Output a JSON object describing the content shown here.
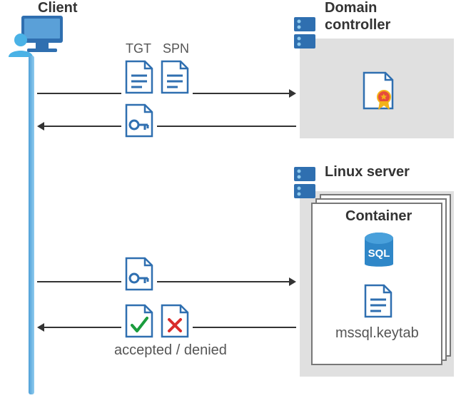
{
  "labels": {
    "client": "Client",
    "domain_controller_l1": "Domain",
    "domain_controller_l2": "controller",
    "linux_server": "Linux server",
    "container": "Container",
    "tgt": "TGT",
    "spn": "SPN",
    "accepted_denied": "accepted / denied",
    "keytab": "mssql.keytab"
  },
  "icons": {
    "sql_text": "SQL"
  },
  "chart_data": {
    "type": "diagram",
    "nodes": [
      {
        "id": "client",
        "label": "Client"
      },
      {
        "id": "dc",
        "label": "Domain controller"
      },
      {
        "id": "linux",
        "label": "Linux server",
        "contains": [
          {
            "id": "container",
            "label": "Container",
            "items": [
              "SQL",
              "mssql.keytab"
            ]
          }
        ]
      }
    ],
    "flows": [
      {
        "from": "client",
        "to": "dc",
        "payload": [
          "TGT",
          "SPN"
        ],
        "direction": "request"
      },
      {
        "from": "dc",
        "to": "client",
        "payload": [
          "session-key"
        ],
        "direction": "response"
      },
      {
        "from": "client",
        "to": "linux",
        "payload": [
          "session-key"
        ],
        "direction": "request"
      },
      {
        "from": "linux",
        "to": "client",
        "payload": [
          "accepted",
          "denied"
        ],
        "direction": "response",
        "note": "accepted / denied"
      }
    ]
  }
}
